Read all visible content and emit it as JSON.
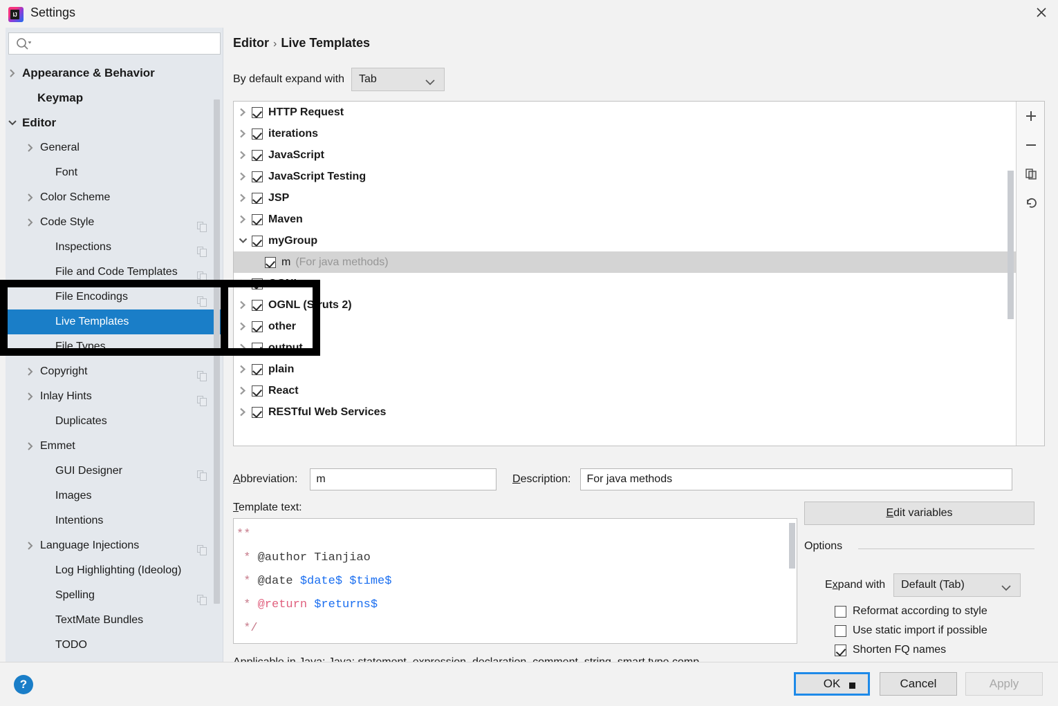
{
  "window": {
    "title": "Settings",
    "logo_text": "IJ",
    "close_icon": "close-icon"
  },
  "sidebar": {
    "search": {
      "value": "",
      "placeholder": "",
      "icon": "search-icon"
    },
    "items": [
      {
        "label": "Appearance & Behavior",
        "arrow": "right",
        "bold": true,
        "indent": 18,
        "copy": false,
        "selected": false
      },
      {
        "label": "Keymap",
        "arrow": "none",
        "bold": true,
        "indent": 40,
        "copy": false,
        "selected": false
      },
      {
        "label": "Editor",
        "arrow": "down",
        "bold": true,
        "indent": 18,
        "copy": false,
        "selected": false
      },
      {
        "label": "General",
        "arrow": "right",
        "bold": false,
        "indent": 44,
        "copy": false,
        "selected": false
      },
      {
        "label": "Font",
        "arrow": "none",
        "bold": false,
        "indent": 66,
        "copy": false,
        "selected": false
      },
      {
        "label": "Color Scheme",
        "arrow": "right",
        "bold": false,
        "indent": 44,
        "copy": false,
        "selected": false
      },
      {
        "label": "Code Style",
        "arrow": "right",
        "bold": false,
        "indent": 44,
        "copy": true,
        "selected": false
      },
      {
        "label": "Inspections",
        "arrow": "none",
        "bold": false,
        "indent": 66,
        "copy": true,
        "selected": false
      },
      {
        "label": "File and Code Templates",
        "arrow": "none",
        "bold": false,
        "indent": 66,
        "copy": true,
        "selected": false
      },
      {
        "label": "File Encodings",
        "arrow": "none",
        "bold": false,
        "indent": 66,
        "copy": true,
        "selected": false
      },
      {
        "label": "Live Templates",
        "arrow": "none",
        "bold": false,
        "indent": 66,
        "copy": false,
        "selected": true
      },
      {
        "label": "File Types",
        "arrow": "none",
        "bold": false,
        "indent": 66,
        "copy": false,
        "selected": false
      },
      {
        "label": "Copyright",
        "arrow": "right",
        "bold": false,
        "indent": 44,
        "copy": true,
        "selected": false
      },
      {
        "label": "Inlay Hints",
        "arrow": "right",
        "bold": false,
        "indent": 44,
        "copy": true,
        "selected": false
      },
      {
        "label": "Duplicates",
        "arrow": "none",
        "bold": false,
        "indent": 66,
        "copy": false,
        "selected": false
      },
      {
        "label": "Emmet",
        "arrow": "right",
        "bold": false,
        "indent": 44,
        "copy": false,
        "selected": false
      },
      {
        "label": "GUI Designer",
        "arrow": "none",
        "bold": false,
        "indent": 66,
        "copy": true,
        "selected": false
      },
      {
        "label": "Images",
        "arrow": "none",
        "bold": false,
        "indent": 66,
        "copy": false,
        "selected": false
      },
      {
        "label": "Intentions",
        "arrow": "none",
        "bold": false,
        "indent": 66,
        "copy": false,
        "selected": false
      },
      {
        "label": "Language Injections",
        "arrow": "right",
        "bold": false,
        "indent": 44,
        "copy": true,
        "selected": false
      },
      {
        "label": "Log Highlighting (Ideolog)",
        "arrow": "none",
        "bold": false,
        "indent": 66,
        "copy": false,
        "selected": false
      },
      {
        "label": "Spelling",
        "arrow": "none",
        "bold": false,
        "indent": 66,
        "copy": true,
        "selected": false
      },
      {
        "label": "TextMate Bundles",
        "arrow": "none",
        "bold": false,
        "indent": 66,
        "copy": false,
        "selected": false
      },
      {
        "label": "TODO",
        "arrow": "none",
        "bold": false,
        "indent": 66,
        "copy": false,
        "selected": false
      }
    ]
  },
  "main": {
    "breadcrumb": {
      "parent": "Editor",
      "separator": "›",
      "current": "Live Templates"
    },
    "expand_with": {
      "label": "By default expand with",
      "value": "Tab"
    },
    "template_tree": {
      "rows": [
        {
          "name": "HTTP Request",
          "desc": "",
          "arrow": "right",
          "checked": true,
          "leaf": false,
          "selected": false
        },
        {
          "name": "iterations",
          "desc": "",
          "arrow": "right",
          "checked": true,
          "leaf": false,
          "selected": false
        },
        {
          "name": "JavaScript",
          "desc": "",
          "arrow": "right",
          "checked": true,
          "leaf": false,
          "selected": false
        },
        {
          "name": "JavaScript Testing",
          "desc": "",
          "arrow": "right",
          "checked": true,
          "leaf": false,
          "selected": false
        },
        {
          "name": "JSP",
          "desc": "",
          "arrow": "right",
          "checked": true,
          "leaf": false,
          "selected": false
        },
        {
          "name": "Maven",
          "desc": "",
          "arrow": "right",
          "checked": true,
          "leaf": false,
          "selected": false
        },
        {
          "name": "myGroup",
          "desc": "",
          "arrow": "down",
          "checked": true,
          "leaf": false,
          "selected": false
        },
        {
          "name": "m",
          "desc": "(For java methods)",
          "arrow": "none",
          "checked": true,
          "leaf": true,
          "selected": true
        },
        {
          "name": "OGNL",
          "desc": "",
          "arrow": "right",
          "checked": true,
          "leaf": false,
          "selected": false
        },
        {
          "name": "OGNL (Struts 2)",
          "desc": "",
          "arrow": "right",
          "checked": true,
          "leaf": false,
          "selected": false
        },
        {
          "name": "other",
          "desc": "",
          "arrow": "right",
          "checked": true,
          "leaf": false,
          "selected": false
        },
        {
          "name": "output",
          "desc": "",
          "arrow": "right",
          "checked": true,
          "leaf": false,
          "selected": false
        },
        {
          "name": "plain",
          "desc": "",
          "arrow": "right",
          "checked": true,
          "leaf": false,
          "selected": false
        },
        {
          "name": "React",
          "desc": "",
          "arrow": "right",
          "checked": true,
          "leaf": false,
          "selected": false
        },
        {
          "name": "RESTful Web Services",
          "desc": "",
          "arrow": "right",
          "checked": true,
          "leaf": false,
          "selected": false
        }
      ],
      "toolbar": [
        {
          "name": "add-template-button",
          "icon": "plus-icon"
        },
        {
          "name": "remove-template-button",
          "icon": "minus-icon"
        },
        {
          "name": "copy-template-button",
          "icon": "copy-icon"
        },
        {
          "name": "revert-template-button",
          "icon": "undo-icon"
        }
      ]
    },
    "abbreviation": {
      "label": "Abbreviation:",
      "mnemonic": "A",
      "value": "m"
    },
    "description": {
      "label": "Description:",
      "mnemonic": "D",
      "value": "For java methods"
    },
    "template_text": {
      "label": "Template text:",
      "mnemonic": "T",
      "lines": [
        [
          {
            "t": "**",
            "c": "c-com"
          }
        ],
        [
          {
            "t": " * ",
            "c": "c-com"
          },
          {
            "t": "@author Tianjiao",
            "c": "c-txt"
          }
        ],
        [
          {
            "t": " * ",
            "c": "c-com"
          },
          {
            "t": "@date ",
            "c": "c-txt"
          },
          {
            "t": "$date$ $time$",
            "c": "c-var"
          }
        ],
        [
          {
            "t": " * ",
            "c": "c-com"
          },
          {
            "t": "@return ",
            "c": "c-tag"
          },
          {
            "t": "$returns$",
            "c": "c-var"
          }
        ],
        [
          {
            "t": " */",
            "c": "c-com"
          }
        ]
      ]
    },
    "applicable_text": "Applicable in Java; Java: statement, expression, declaration, comment, string, smart type comp..",
    "edit_variables": {
      "label": "Edit variables",
      "mnemonic": "E"
    },
    "options": {
      "title": "Options",
      "expand_with": {
        "label": "Expand with",
        "mnemonic": "x",
        "value": "Default (Tab)"
      },
      "checkboxes": [
        {
          "label": "Reformat according to style",
          "checked": false
        },
        {
          "label": "Use static import if possible",
          "checked": false
        },
        {
          "label": "Shorten FQ names",
          "checked": true
        }
      ]
    }
  },
  "footer": {
    "help": "?",
    "ok": "OK",
    "cancel": "Cancel",
    "apply": "Apply"
  },
  "colors": {
    "accent": "#1a7ec8",
    "focus_border": "#1e8ae8",
    "selected_row": "#d4d4d4",
    "sidebar_bg": "#e4e8ed",
    "window_bg": "#f2f2f2",
    "var_blue": "#1a6ef0",
    "comment_pink": "#c77b8b",
    "tag_red": "#e0607e"
  }
}
